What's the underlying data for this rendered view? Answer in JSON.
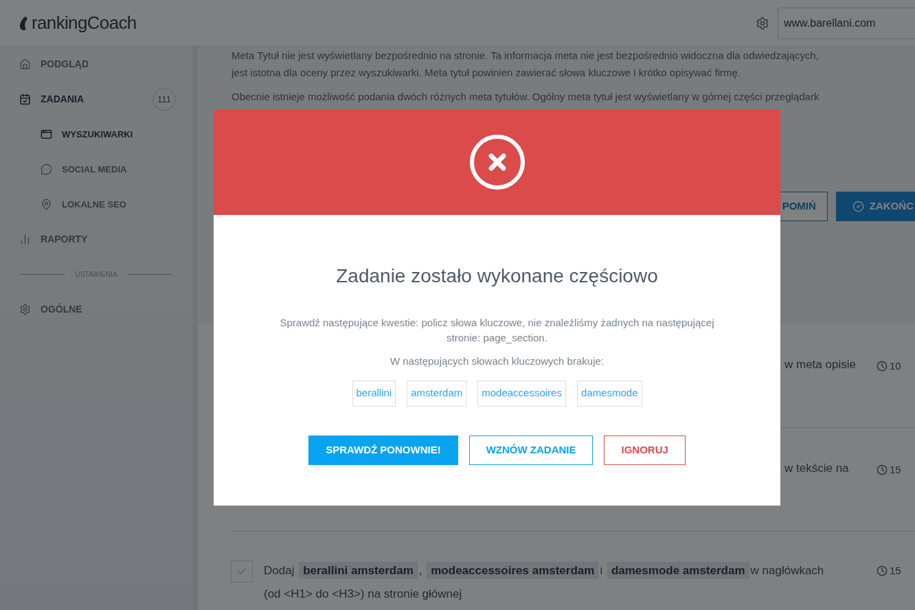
{
  "header": {
    "logo": "rankingCoach",
    "website": "www.barellani.com"
  },
  "sidebar": {
    "items": [
      {
        "label": "PODGLĄD",
        "selected": false
      },
      {
        "label": "ZADANIA",
        "selected": true,
        "badge": "111",
        "children": [
          {
            "label": "WYSZUKIWARKI",
            "selected": true
          },
          {
            "label": "SOCIAL MEDIA",
            "selected": false
          },
          {
            "label": "LOKALNE SEO",
            "selected": false
          }
        ]
      },
      {
        "label": "RAPORTY",
        "selected": false
      }
    ],
    "section_label": "USTAWIENIA",
    "settings_items": [
      {
        "label": "OGÓLNE",
        "selected": false
      }
    ]
  },
  "content": {
    "paragraphs": [
      "Meta Tytuł nie jest wyświetlany bezpośrednio na stronie. Ta informacja meta nie jest bezpośrednio widoczna dla odwiedzających,",
      "jest istotna dla oceny przez wyszukiwarki. Meta tytuł powinien zawierać słowa kluczowe i krótko opisywać firmę.",
      "Obecnie istnieje możliwość podania dwóch różnych meta tytułów. Ogólny meta tytuł jest wyświetlany w górnej części przeglądark"
    ],
    "buttons": [
      {
        "label": "POMIŃ",
        "kind": "outline"
      },
      {
        "label": "ZAKOŃC",
        "kind": "primary"
      }
    ],
    "tasks": [
      {
        "text": "w meta opisie",
        "time": "10"
      },
      {
        "text": "w tekście na",
        "time": "15"
      },
      {
        "checked": false,
        "parts": [
          {
            "kind": "text",
            "text": "Dodaj"
          },
          {
            "kind": "keyword",
            "text": "berallini amsterdam"
          },
          {
            "kind": "text",
            "text": ","
          },
          {
            "kind": "keyword",
            "text": "modeaccessoires amsterdam"
          },
          {
            "kind": "text",
            "text": "i"
          },
          {
            "kind": "keyword",
            "text": "damesmode amsterdam"
          },
          {
            "kind": "text",
            "text": "w nagłówkach"
          }
        ],
        "second_line": "(od <H1> do <H3>) na stronie głównej",
        "time": "15"
      }
    ]
  },
  "modal": {
    "title": "Zadanie zostało wykonane częściowo",
    "message": "Sprawdź następujące kwestie: policz słowa kluczowe, nie znaleźliśmy żadnych na następującej stronie: page_section.",
    "missing_label": "W następujących słowach kluczowych brakuje:",
    "keywords": [
      "berallini",
      "amsterdam",
      "modeaccessoires",
      "damesmode"
    ],
    "buttons": [
      {
        "label": "SPRAWDŹ PONOWNIE!",
        "kind": "primary"
      },
      {
        "label": "WZNÓW ZADANIE",
        "kind": "outline"
      },
      {
        "label": "IGNORUJ",
        "kind": "danger"
      }
    ]
  }
}
